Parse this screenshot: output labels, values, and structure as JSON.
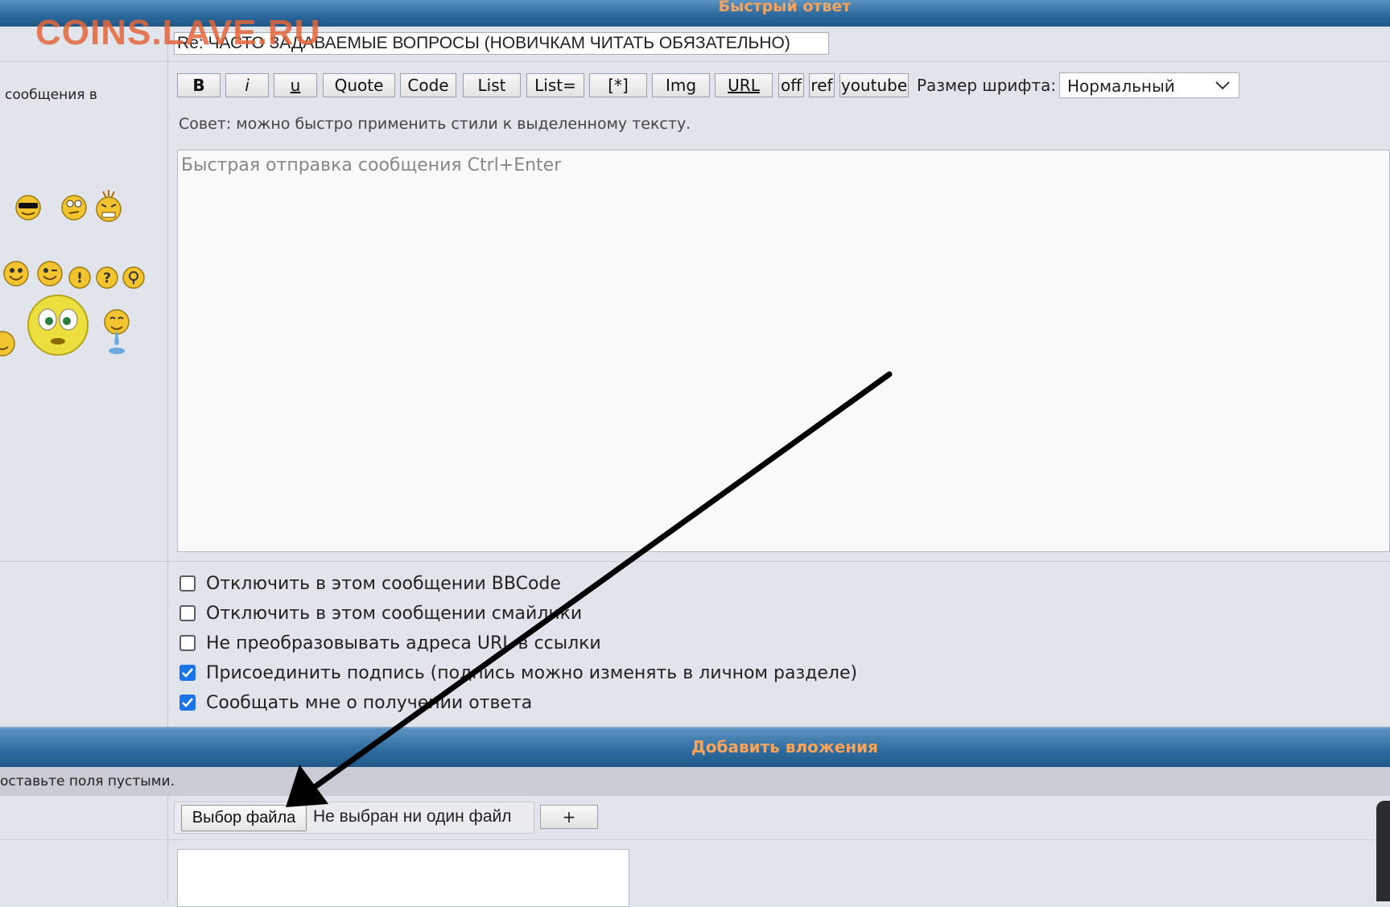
{
  "header": {
    "title": "Быстрый ответ"
  },
  "watermark": "COINS.LAVE.RU",
  "subject": {
    "value": "Re: ЧАСТО ЗАДАВАЕМЫЕ ВОПРОСЫ (НОВИЧКАМ ЧИТАТЬ ОБЯЗАТЕЛЬНО)"
  },
  "left_panel": {
    "label": "сообщения в"
  },
  "toolbar": {
    "buttons": [
      "B",
      "i",
      "u",
      "Quote",
      "Code",
      "List",
      "List=",
      "[*]",
      "Img",
      "URL",
      "off",
      "ref",
      "youtube"
    ],
    "font_size_label": "Размер шрифта:",
    "font_size_value": "Нормальный",
    "tip": "Совет: можно быстро применить стили к выделенному тексту."
  },
  "message": {
    "placeholder": "Быстрая отправка сообщения Ctrl+Enter",
    "value": ""
  },
  "options": [
    {
      "label": "Отключить в этом сообщении BBCode",
      "checked": false
    },
    {
      "label": "Отключить в этом сообщении смайлики",
      "checked": false
    },
    {
      "label": "Не преобразовывать адреса URL в ссылки",
      "checked": false
    },
    {
      "label": "Присоединить подпись (подпись можно изменять в личном разделе)",
      "checked": true
    },
    {
      "label": "Сообщать мне о получении ответа",
      "checked": true
    }
  ],
  "attachments": {
    "title": "Добавить вложения",
    "hint": "оставьте поля пустыми.",
    "choose_file_label": "Выбор файла",
    "no_file_label": "Не выбран ни один файл",
    "add_label": "+"
  },
  "colors": {
    "header_blue": "#2e6b9e",
    "header_text": "#f7a35c",
    "checkbox_blue": "#1a73e8",
    "watermark": "#e4663a"
  }
}
